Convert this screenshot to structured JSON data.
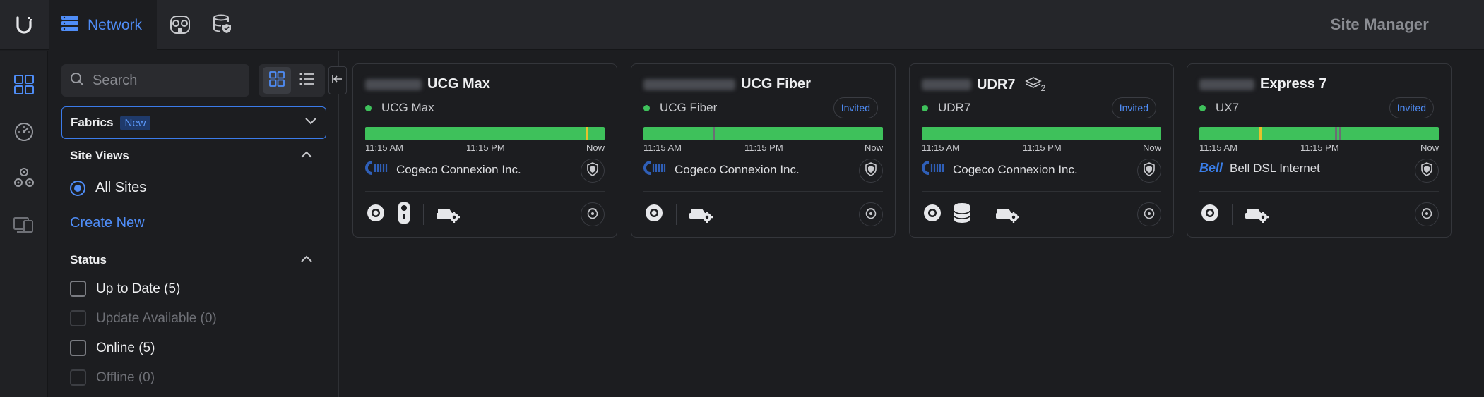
{
  "topbar": {
    "app_name": "Network",
    "site_manager": "Site Manager"
  },
  "sidebar": {
    "search_placeholder": "Search",
    "fabrics_label": "Fabrics",
    "fabrics_badge": "New",
    "site_views_title": "Site Views",
    "all_sites_label": "All Sites",
    "create_new_label": "Create New",
    "status_title": "Status",
    "status_items": [
      {
        "label": "Up to Date (5)",
        "disabled": false
      },
      {
        "label": "Update Available (0)",
        "disabled": true
      },
      {
        "label": "Online (5)",
        "disabled": false
      },
      {
        "label": "Offline (0)",
        "disabled": true
      }
    ]
  },
  "cards": [
    {
      "title": "UCG Max",
      "model": "UCG Max",
      "invited": "",
      "uptime_marks": [
        {
          "pos": 0.92,
          "color": "#e8c12c"
        }
      ],
      "time_start": "11:15 AM",
      "time_mid": "11:15 PM",
      "time_end": "Now",
      "isp": "Cogeco Connexion Inc.",
      "isp_logo": "cogeco",
      "devices": [
        "console-icon",
        "camera-icon"
      ],
      "accent": "#3ec15b"
    },
    {
      "title": "UCG Fiber",
      "model": "UCG Fiber",
      "invited": "Invited",
      "uptime_marks": [
        {
          "pos": 0.29,
          "color": "#6b6e74"
        }
      ],
      "time_start": "11:15 AM",
      "time_mid": "11:15 PM",
      "time_end": "Now",
      "isp": "Cogeco Connexion Inc.",
      "isp_logo": "cogeco",
      "devices": [
        "console-icon"
      ],
      "accent": "#3ec15b"
    },
    {
      "title": "UDR7",
      "title_badge": "2",
      "model": "UDR7",
      "invited": "Invited",
      "uptime_marks": [],
      "time_start": "11:15 AM",
      "time_mid": "11:15 PM",
      "time_end": "Now",
      "isp": "Cogeco Connexion Inc.",
      "isp_logo": "cogeco",
      "devices": [
        "console-icon",
        "storage-icon"
      ],
      "accent": "#3ec15b"
    },
    {
      "title": "Express 7",
      "model": "UX7",
      "invited": "Invited",
      "uptime_marks": [
        {
          "pos": 0.25,
          "color": "#e8c12c"
        },
        {
          "pos": 0.565,
          "color": "#6b6e74"
        },
        {
          "pos": 0.585,
          "color": "#6b6e74"
        }
      ],
      "time_start": "11:15 AM",
      "time_mid": "11:15 PM",
      "time_end": "Now",
      "isp": "Bell DSL Internet",
      "isp_logo": "bell",
      "devices": [
        "console-icon"
      ],
      "accent": "#3ec15b"
    }
  ]
}
